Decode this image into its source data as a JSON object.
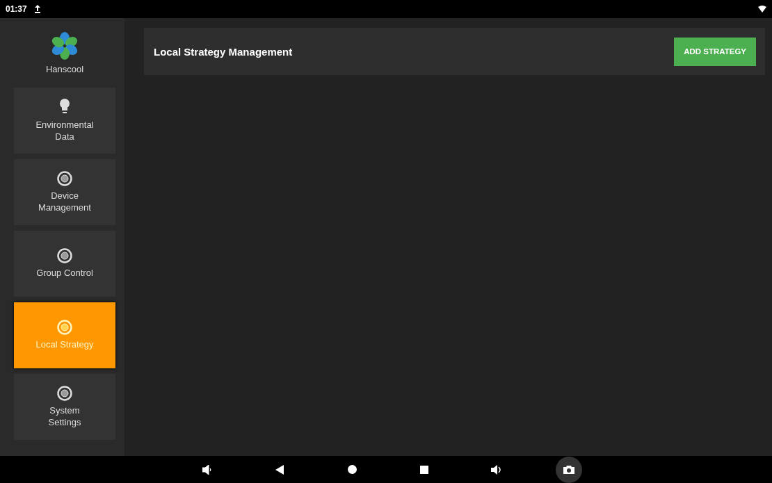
{
  "status_bar": {
    "time": "01:37"
  },
  "sidebar": {
    "brand": "Hanscool",
    "items": [
      {
        "label": "Environmental Data",
        "kind": "bulb",
        "selected": false
      },
      {
        "label": "Device Management",
        "kind": "radio",
        "selected": false
      },
      {
        "label": "Group Control",
        "kind": "radio",
        "selected": false
      },
      {
        "label": "Local Strategy",
        "kind": "radio",
        "selected": true
      },
      {
        "label": "System Settings",
        "kind": "radio",
        "selected": false
      }
    ]
  },
  "header": {
    "title": "Local Strategy Management",
    "button": "ADD STRATEGY"
  }
}
